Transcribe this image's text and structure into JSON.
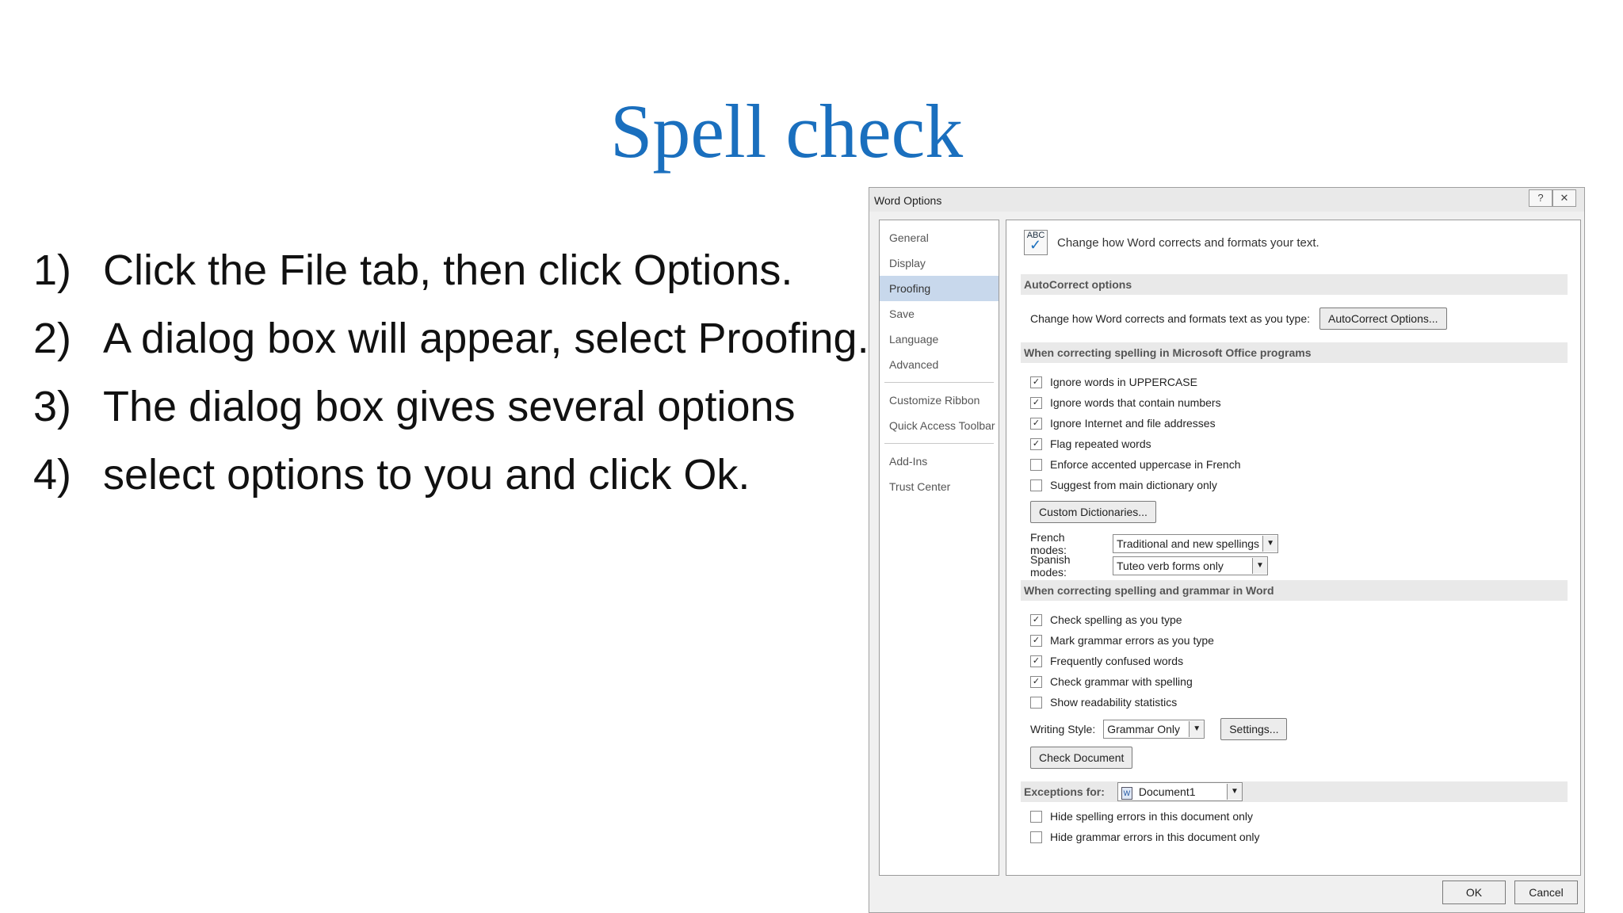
{
  "slide": {
    "title": "Spell check",
    "steps": [
      {
        "num": "1)",
        "text": "Click the File tab, then click Options."
      },
      {
        "num": "2)",
        "text": "A dialog box will appear, select Proofing."
      },
      {
        "num": "3)",
        "text": "The dialog box gives several options"
      },
      {
        "num": "4)",
        "text": "select options to you and click Ok."
      }
    ]
  },
  "dialog": {
    "title": "Word Options",
    "help_glyph": "?",
    "close_glyph": "✕",
    "nav": [
      {
        "label": "General"
      },
      {
        "label": "Display"
      },
      {
        "label": "Proofing"
      },
      {
        "label": "Save"
      },
      {
        "label": "Language"
      },
      {
        "label": "Advanced"
      },
      {
        "label": "Customize Ribbon"
      },
      {
        "label": "Quick Access Toolbar"
      },
      {
        "label": "Add-Ins"
      },
      {
        "label": "Trust Center"
      }
    ],
    "header_icon_text": "ABC",
    "header_text": "Change how Word corrects and formats your text.",
    "autocorrect": {
      "heading": "AutoCorrect options",
      "label": "Change how Word corrects and formats text as you type:",
      "button": "AutoCorrect Options..."
    },
    "office": {
      "heading": "When correcting spelling in Microsoft Office programs",
      "options": [
        {
          "label": "Ignore words in UPPERCASE",
          "checked": true
        },
        {
          "label": "Ignore words that contain numbers",
          "checked": true
        },
        {
          "label": "Ignore Internet and file addresses",
          "checked": true
        },
        {
          "label": "Flag repeated words",
          "checked": true
        },
        {
          "label": "Enforce accented uppercase in French",
          "checked": false
        },
        {
          "label": "Suggest from main dictionary only",
          "checked": false
        }
      ],
      "custom_dict_button": "Custom Dictionaries...",
      "french_label": "French modes:",
      "french_value": "Traditional and new spellings",
      "spanish_label": "Spanish modes:",
      "spanish_value": "Tuteo verb forms only"
    },
    "word": {
      "heading": "When correcting spelling and grammar in Word",
      "options": [
        {
          "label": "Check spelling as you type",
          "checked": true
        },
        {
          "label": "Mark grammar errors as you type",
          "checked": true
        },
        {
          "label": "Frequently confused words",
          "checked": true
        },
        {
          "label": "Check grammar with spelling",
          "checked": true
        },
        {
          "label": "Show readability statistics",
          "checked": false
        }
      ],
      "writing_style_label": "Writing Style:",
      "writing_style_value": "Grammar Only",
      "settings_button": "Settings...",
      "check_document_button": "Check Document"
    },
    "exceptions": {
      "label": "Exceptions for:",
      "value": "Document1",
      "options": [
        {
          "label": "Hide spelling errors in this document only",
          "checked": false
        },
        {
          "label": "Hide grammar errors in this document only",
          "checked": false
        }
      ]
    },
    "ok": "OK",
    "cancel": "Cancel"
  }
}
